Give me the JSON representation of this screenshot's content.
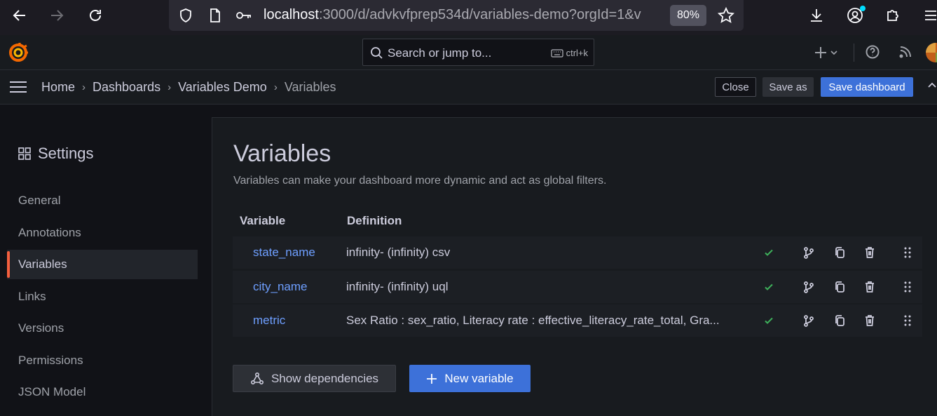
{
  "browser": {
    "url_host": "localhost",
    "url_rest": ":3000/d/advkvfprep534d/variables-demo?orgId=1&v",
    "zoom": "80%"
  },
  "topbar": {
    "search_placeholder": "Search or jump to...",
    "search_shortcut": "ctrl+k"
  },
  "breadcrumb": {
    "items": [
      "Home",
      "Dashboards",
      "Variables Demo",
      "Variables"
    ]
  },
  "actions": {
    "close": "Close",
    "save_as": "Save as",
    "save_dashboard": "Save dashboard"
  },
  "sidebar": {
    "title": "Settings",
    "items": [
      "General",
      "Annotations",
      "Variables",
      "Links",
      "Versions",
      "Permissions",
      "JSON Model"
    ],
    "active": "Variables"
  },
  "main": {
    "title": "Variables",
    "subtitle": "Variables can make your dashboard more dynamic and act as global filters.",
    "columns": [
      "Variable",
      "Definition"
    ],
    "rows": [
      {
        "name": "state_name",
        "definition": "infinity- (infinity) csv"
      },
      {
        "name": "city_name",
        "definition": "infinity- (infinity) uql"
      },
      {
        "name": "metric",
        "definition": "Sex Ratio : sex_ratio, Literacy rate : effective_literacy_rate_total, Gra..."
      }
    ],
    "show_dependencies": "Show dependencies",
    "new_variable": "New variable"
  },
  "colors": {
    "accent": "#3d71d9",
    "link": "#6e9fff",
    "active_marker": "#f55f3e",
    "ok": "#3eb15b"
  }
}
